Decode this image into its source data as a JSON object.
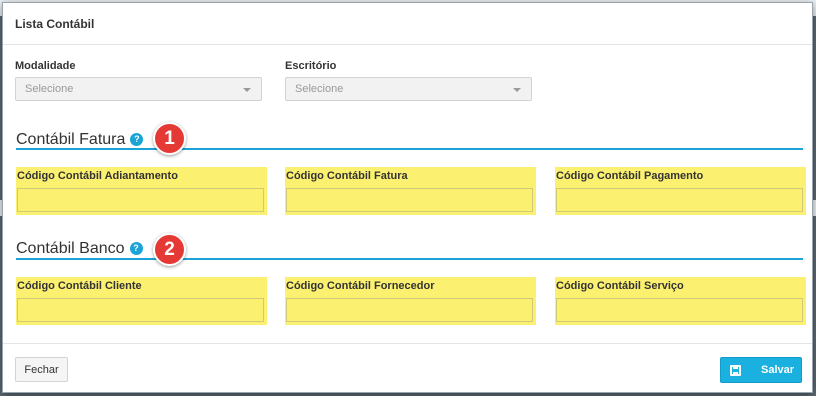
{
  "modal": {
    "title": "Lista Contábil"
  },
  "filters": {
    "modalidade": {
      "label": "Modalidade",
      "placeholder": "Selecione"
    },
    "escritorio": {
      "label": "Escritório",
      "placeholder": "Selecione"
    }
  },
  "sections": [
    {
      "title": "Contábil Fatura",
      "badge": "1",
      "fields": [
        {
          "label": "Código Contábil Adiantamento",
          "value": ""
        },
        {
          "label": "Código Contábil Fatura",
          "value": ""
        },
        {
          "label": "Código Contábil Pagamento",
          "value": ""
        }
      ]
    },
    {
      "title": "Contábil Banco",
      "badge": "2",
      "fields": [
        {
          "label": "Código Contábil Cliente",
          "value": ""
        },
        {
          "label": "Código Contábil Fornecedor",
          "value": ""
        },
        {
          "label": "Código Contábil Serviço",
          "value": ""
        }
      ]
    }
  ],
  "footer": {
    "close_label": "Fechar",
    "save_label": "Salvar"
  },
  "colors": {
    "accent": "#1aa3d6",
    "highlight": "#fbf070",
    "badge": "#e53935"
  },
  "icons": {
    "help": "question-circle-icon",
    "save": "floppy-disk-icon",
    "caret": "caret-down-icon"
  }
}
